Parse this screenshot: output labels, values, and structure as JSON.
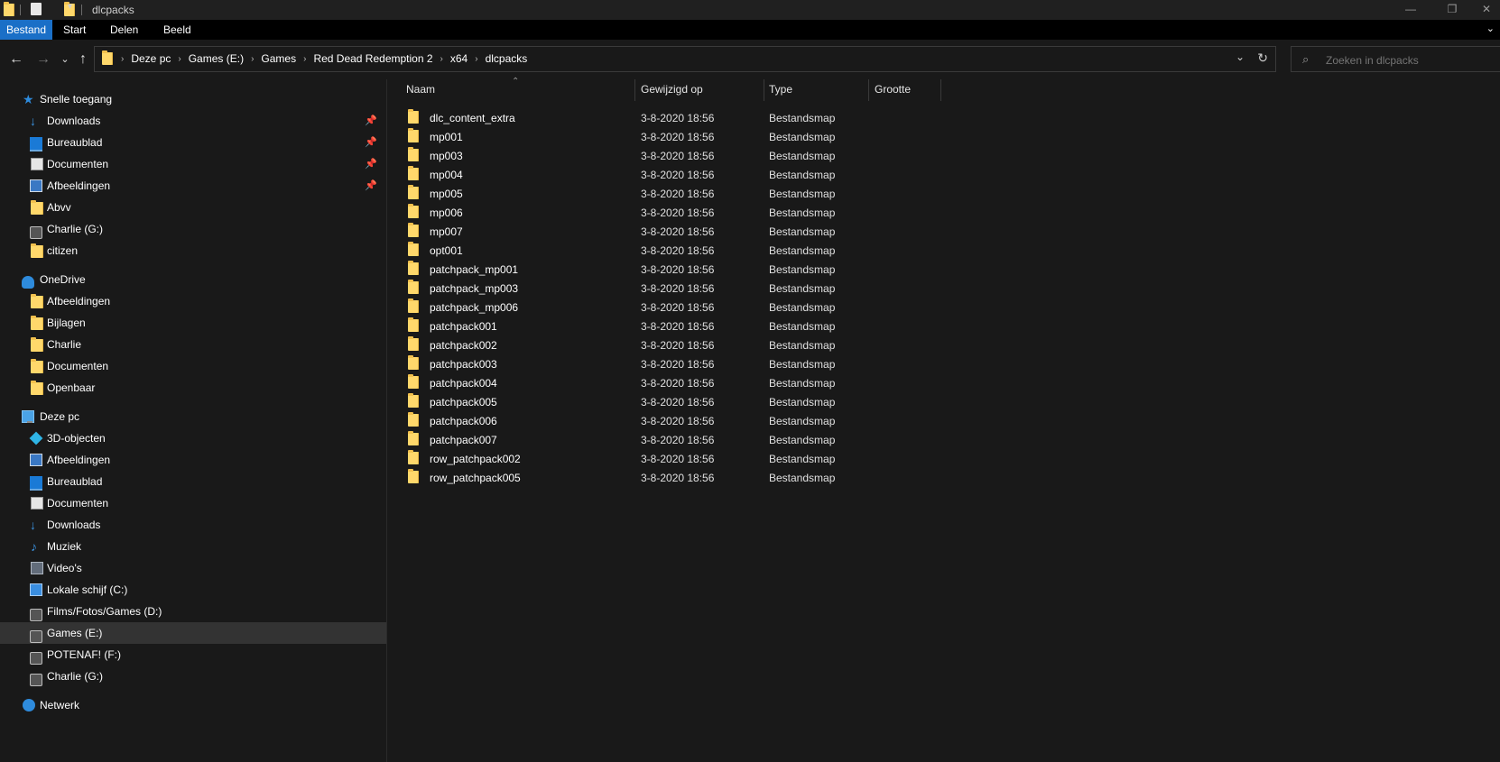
{
  "window": {
    "title": "dlcpacks",
    "minimize": "—",
    "restore": "❐",
    "close": "✕"
  },
  "ribbon": {
    "tabs": [
      "Bestand",
      "Start",
      "Delen",
      "Beeld"
    ],
    "active": "Bestand"
  },
  "address": {
    "crumbs": [
      "Deze pc",
      "Games (E:)",
      "Games",
      "Red Dead Redemption 2",
      "x64",
      "dlcpacks"
    ]
  },
  "search": {
    "placeholder": "Zoeken in dlcpacks"
  },
  "sidebar": {
    "items": [
      {
        "label": "Snelle toegang",
        "icon": "star-icon",
        "level": 0,
        "pinned": false
      },
      {
        "label": "Downloads",
        "icon": "download-icon",
        "level": 1,
        "pinned": true
      },
      {
        "label": "Bureaublad",
        "icon": "desktop-icon",
        "level": 1,
        "pinned": true
      },
      {
        "label": "Documenten",
        "icon": "document-icon",
        "level": 1,
        "pinned": true
      },
      {
        "label": "Afbeeldingen",
        "icon": "pictures-icon",
        "level": 1,
        "pinned": true
      },
      {
        "label": "Abvv",
        "icon": "folder-icon",
        "level": 1,
        "pinned": false
      },
      {
        "label": "Charlie (G:)",
        "icon": "drive-icon",
        "level": 1,
        "pinned": false
      },
      {
        "label": "citizen",
        "icon": "folder-icon",
        "level": 1,
        "pinned": false
      },
      {
        "label": "OneDrive",
        "icon": "cloud-icon",
        "level": 0,
        "pinned": false
      },
      {
        "label": "Afbeeldingen",
        "icon": "folder-icon",
        "level": 1,
        "pinned": false
      },
      {
        "label": "Bijlagen",
        "icon": "folder-icon",
        "level": 1,
        "pinned": false
      },
      {
        "label": "Charlie",
        "icon": "folder-icon",
        "level": 1,
        "pinned": false
      },
      {
        "label": "Documenten",
        "icon": "folder-icon",
        "level": 1,
        "pinned": false
      },
      {
        "label": "Openbaar",
        "icon": "folder-icon",
        "level": 1,
        "pinned": false
      },
      {
        "label": "Deze pc",
        "icon": "computer-icon",
        "level": 0,
        "pinned": false
      },
      {
        "label": "3D-objecten",
        "icon": "3d-objects-icon",
        "level": 1,
        "pinned": false
      },
      {
        "label": "Afbeeldingen",
        "icon": "pictures-icon",
        "level": 1,
        "pinned": false
      },
      {
        "label": "Bureaublad",
        "icon": "desktop-icon",
        "level": 1,
        "pinned": false
      },
      {
        "label": "Documenten",
        "icon": "document-icon",
        "level": 1,
        "pinned": false
      },
      {
        "label": "Downloads",
        "icon": "download-icon",
        "level": 1,
        "pinned": false
      },
      {
        "label": "Muziek",
        "icon": "music-icon",
        "level": 1,
        "pinned": false
      },
      {
        "label": "Video's",
        "icon": "video-icon",
        "level": 1,
        "pinned": false
      },
      {
        "label": "Lokale schijf (C:)",
        "icon": "system-drive-icon",
        "level": 1,
        "pinned": false
      },
      {
        "label": "Films/Fotos/Games (D:)",
        "icon": "drive-icon",
        "level": 1,
        "pinned": false
      },
      {
        "label": "Games (E:)",
        "icon": "drive-icon",
        "level": 1,
        "pinned": false,
        "selected": true
      },
      {
        "label": "POTENAF! (F:)",
        "icon": "drive-icon",
        "level": 1,
        "pinned": false
      },
      {
        "label": "Charlie (G:)",
        "icon": "drive-icon",
        "level": 1,
        "pinned": false
      },
      {
        "label": "Netwerk",
        "icon": "network-icon",
        "level": 0,
        "pinned": false
      }
    ]
  },
  "columns": {
    "name": "Naam",
    "modified": "Gewijzigd op",
    "type": "Type",
    "size": "Grootte"
  },
  "files": [
    {
      "name": "dlc_content_extra",
      "date": "3-8-2020 18:56",
      "type": "Bestandsmap"
    },
    {
      "name": "mp001",
      "date": "3-8-2020 18:56",
      "type": "Bestandsmap"
    },
    {
      "name": "mp003",
      "date": "3-8-2020 18:56",
      "type": "Bestandsmap"
    },
    {
      "name": "mp004",
      "date": "3-8-2020 18:56",
      "type": "Bestandsmap"
    },
    {
      "name": "mp005",
      "date": "3-8-2020 18:56",
      "type": "Bestandsmap"
    },
    {
      "name": "mp006",
      "date": "3-8-2020 18:56",
      "type": "Bestandsmap"
    },
    {
      "name": "mp007",
      "date": "3-8-2020 18:56",
      "type": "Bestandsmap"
    },
    {
      "name": "opt001",
      "date": "3-8-2020 18:56",
      "type": "Bestandsmap"
    },
    {
      "name": "patchpack_mp001",
      "date": "3-8-2020 18:56",
      "type": "Bestandsmap"
    },
    {
      "name": "patchpack_mp003",
      "date": "3-8-2020 18:56",
      "type": "Bestandsmap"
    },
    {
      "name": "patchpack_mp006",
      "date": "3-8-2020 18:56",
      "type": "Bestandsmap"
    },
    {
      "name": "patchpack001",
      "date": "3-8-2020 18:56",
      "type": "Bestandsmap"
    },
    {
      "name": "patchpack002",
      "date": "3-8-2020 18:56",
      "type": "Bestandsmap"
    },
    {
      "name": "patchpack003",
      "date": "3-8-2020 18:56",
      "type": "Bestandsmap"
    },
    {
      "name": "patchpack004",
      "date": "3-8-2020 18:56",
      "type": "Bestandsmap"
    },
    {
      "name": "patchpack005",
      "date": "3-8-2020 18:56",
      "type": "Bestandsmap"
    },
    {
      "name": "patchpack006",
      "date": "3-8-2020 18:56",
      "type": "Bestandsmap"
    },
    {
      "name": "patchpack007",
      "date": "3-8-2020 18:56",
      "type": "Bestandsmap"
    },
    {
      "name": "row_patchpack002",
      "date": "3-8-2020 18:56",
      "type": "Bestandsmap"
    },
    {
      "name": "row_patchpack005",
      "date": "3-8-2020 18:56",
      "type": "Bestandsmap"
    }
  ]
}
